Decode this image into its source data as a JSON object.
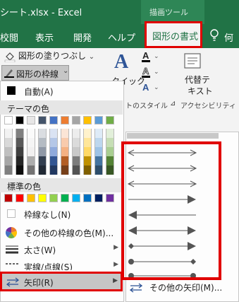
{
  "title_bar": {
    "title": "シート.xlsx - Excel",
    "context_group": "描画ツール"
  },
  "tabs": {
    "file": "校閲",
    "view": "表示",
    "developer": "開発",
    "help": "ヘルプ",
    "shape_format": "図形の書式",
    "tell_me": "何"
  },
  "ribbon": {
    "shape_fill": "図形の塗りつぶし",
    "shape_outline": "図形の枠線",
    "quick_styles": "クイック",
    "quick_styles_2": "ル",
    "text_style_group": "トのスタイル",
    "alt_text_line1": "代替テ",
    "alt_text_line2": "キスト",
    "accessibility_group": "アクセシビリティ"
  },
  "menu": {
    "automatic": "自動(A)",
    "theme_colors_header": "テーマの色",
    "standard_colors_header": "標準の色",
    "no_outline": "枠線なし(N)",
    "more_outline_colors": "その他の枠線の色(M)...",
    "weight": "太さ(W)",
    "dashes": "実線/点線(S)",
    "arrows": "矢印(R)"
  },
  "submenu": {
    "more_arrows": "その他の矢印(M)..."
  },
  "colors": {
    "excel_green": "#217346",
    "highlight_red": "#e00000",
    "theme_top": [
      "#ffffff",
      "#000000",
      "#e7e6e6",
      "#44546a",
      "#4472c4",
      "#ed7d31",
      "#a5a5a5",
      "#ffc000",
      "#5b9bd5",
      "#70ad47"
    ],
    "standard": [
      "#c00000",
      "#ff0000",
      "#ffc000",
      "#ffff00",
      "#92d050",
      "#00b050",
      "#00b0f0",
      "#0070c0",
      "#002060",
      "#7030a0"
    ]
  }
}
